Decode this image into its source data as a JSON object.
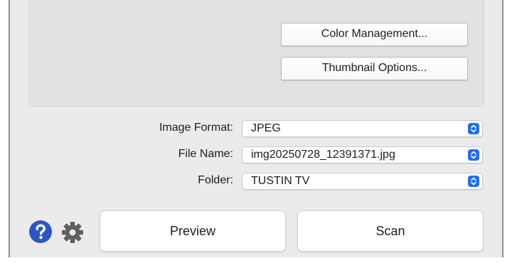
{
  "options": {
    "color_management_label": "Color Management...",
    "thumbnail_options_label": "Thumbnail Options..."
  },
  "form": {
    "image_format": {
      "label": "Image Format:",
      "value": "JPEG"
    },
    "file_name": {
      "label": "File Name:",
      "value": "img20250728_12391371.jpg"
    },
    "folder": {
      "label": "Folder:",
      "value": "TUSTIN TV"
    }
  },
  "footer": {
    "help_icon": "question-circle-icon",
    "settings_icon": "gear-icon",
    "preview_label": "Preview",
    "scan_label": "Scan"
  },
  "colors": {
    "window_background": "#ebebeb",
    "panel_background": "#e2e2e2",
    "accent_blue": "#1d6ff2",
    "help_icon_blue": "#2e55c7",
    "gear_gray": "#606060"
  }
}
